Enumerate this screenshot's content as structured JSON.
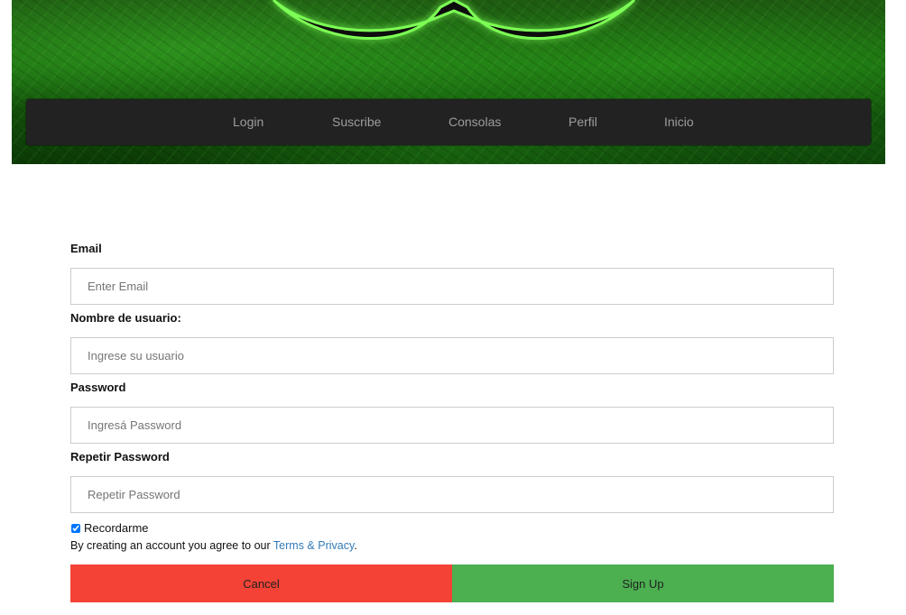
{
  "nav": {
    "items": [
      {
        "label": "Login"
      },
      {
        "label": "Suscribe"
      },
      {
        "label": "Consolas"
      },
      {
        "label": "Perfil"
      },
      {
        "label": "Inicio"
      }
    ]
  },
  "form": {
    "email": {
      "label": "Email",
      "placeholder": "Enter Email"
    },
    "username": {
      "label": "Nombre de usuario:",
      "placeholder": "Ingrese su usuario"
    },
    "password": {
      "label": "Password",
      "placeholder": "Ingresá Password"
    },
    "repeat_password": {
      "label": "Repetir Password",
      "placeholder": "Repetir Password"
    },
    "remember": {
      "label": "Recordarme",
      "checked": true
    },
    "terms": {
      "prefix": "By creating an account you agree to our ",
      "link": "Terms & Privacy",
      "suffix": "."
    },
    "buttons": {
      "cancel": "Cancel",
      "signup": "Sign Up"
    }
  },
  "colors": {
    "navbar_bg": "#222222",
    "nav_text": "#9d9d9d",
    "cancel_bg": "#f44336",
    "signup_bg": "#4caf50",
    "link": "#337ab7"
  },
  "icons": {
    "banner_graphic": "mustache-icon"
  }
}
